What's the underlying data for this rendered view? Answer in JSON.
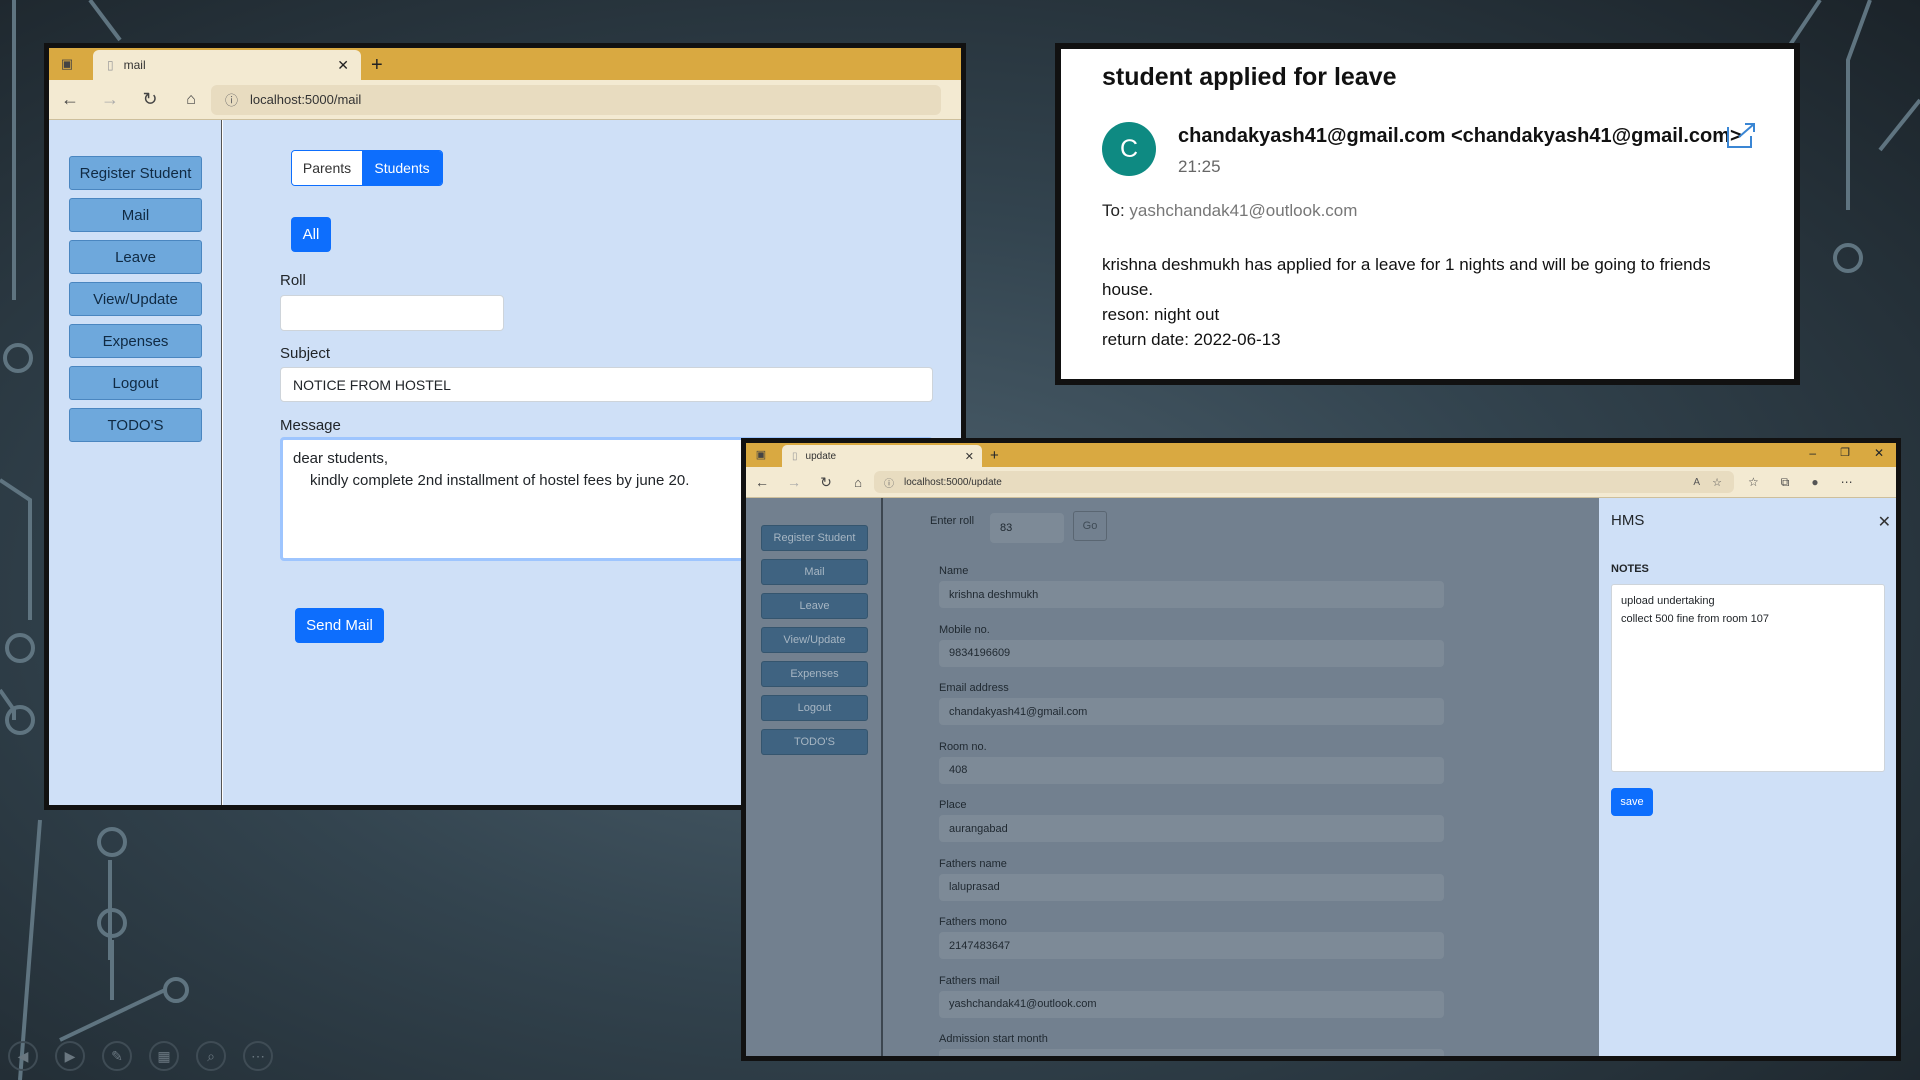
{
  "colors": {
    "accent": "#0d6efd",
    "tabbar": "#d9a941",
    "sidebar_btn": "#6ea8dc",
    "page_bg": "#cfe0f7",
    "avatar": "#0e8a82"
  },
  "mail_window": {
    "tab_title": "mail",
    "url": "localhost:5000/mail",
    "sidebar": [
      "Register Student",
      "Mail",
      "Leave",
      "View/Update",
      "Expenses",
      "Logout",
      "TODO'S"
    ],
    "segment": {
      "parents": "Parents",
      "students": "Students"
    },
    "all_button": "All",
    "roll_label": "Roll",
    "roll_value": "",
    "subject_label": "Subject",
    "subject_value": "NOTICE FROM HOSTEL",
    "message_label": "Message",
    "message_line1": "dear students,",
    "message_line2": "kindly complete 2nd installment of hostel fees by june 20.",
    "send_button": "Send Mail"
  },
  "email_panel": {
    "subject": "student applied for leave",
    "avatar_letter": "C",
    "from": "chandakyash41@gmail.com <chandakyash41@gmail.com>",
    "time": "21:25",
    "to_label": "To:",
    "to_value": "yashchandak41@outlook.com",
    "body_line1": "krishna  deshmukh has applied for a leave for 1 nights and will be going to friends",
    "body_line2": "house.",
    "body_line3": "reson: night out",
    "body_line4": "return date: 2022-06-13"
  },
  "update_window": {
    "tab_title": "update",
    "url": "localhost:5000/update",
    "sidebar": [
      "Register Student",
      "Mail",
      "Leave",
      "View/Update",
      "Expenses",
      "Logout",
      "TODO'S"
    ],
    "enter_roll_label": "Enter roll",
    "roll_value": "83",
    "go_button": "Go",
    "fields": [
      {
        "label": "Name",
        "value": "krishna  deshmukh"
      },
      {
        "label": "Mobile no.",
        "value": "9834196609"
      },
      {
        "label": "Email address",
        "value": "chandakyash41@gmail.com"
      },
      {
        "label": "Room no.",
        "value": "408"
      },
      {
        "label": "Place",
        "value": "aurangabad"
      },
      {
        "label": "Fathers name",
        "value": "laluprasad"
      },
      {
        "label": "Fathers mono",
        "value": "2147483647"
      },
      {
        "label": "Fathers mail",
        "value": "yashchandak41@outlook.com"
      },
      {
        "label": "Admission start month",
        "value": ""
      }
    ],
    "notes_panel": {
      "title": "HMS",
      "notes_label": "NOTES",
      "note_line1": "upload undertaking",
      "note_line2": "collect 500 fine from room 107",
      "save_button": "save"
    }
  },
  "slideshow_controls": [
    "previous-icon",
    "play-icon",
    "pen-icon",
    "grid-icon",
    "zoom-icon",
    "more-icon"
  ]
}
